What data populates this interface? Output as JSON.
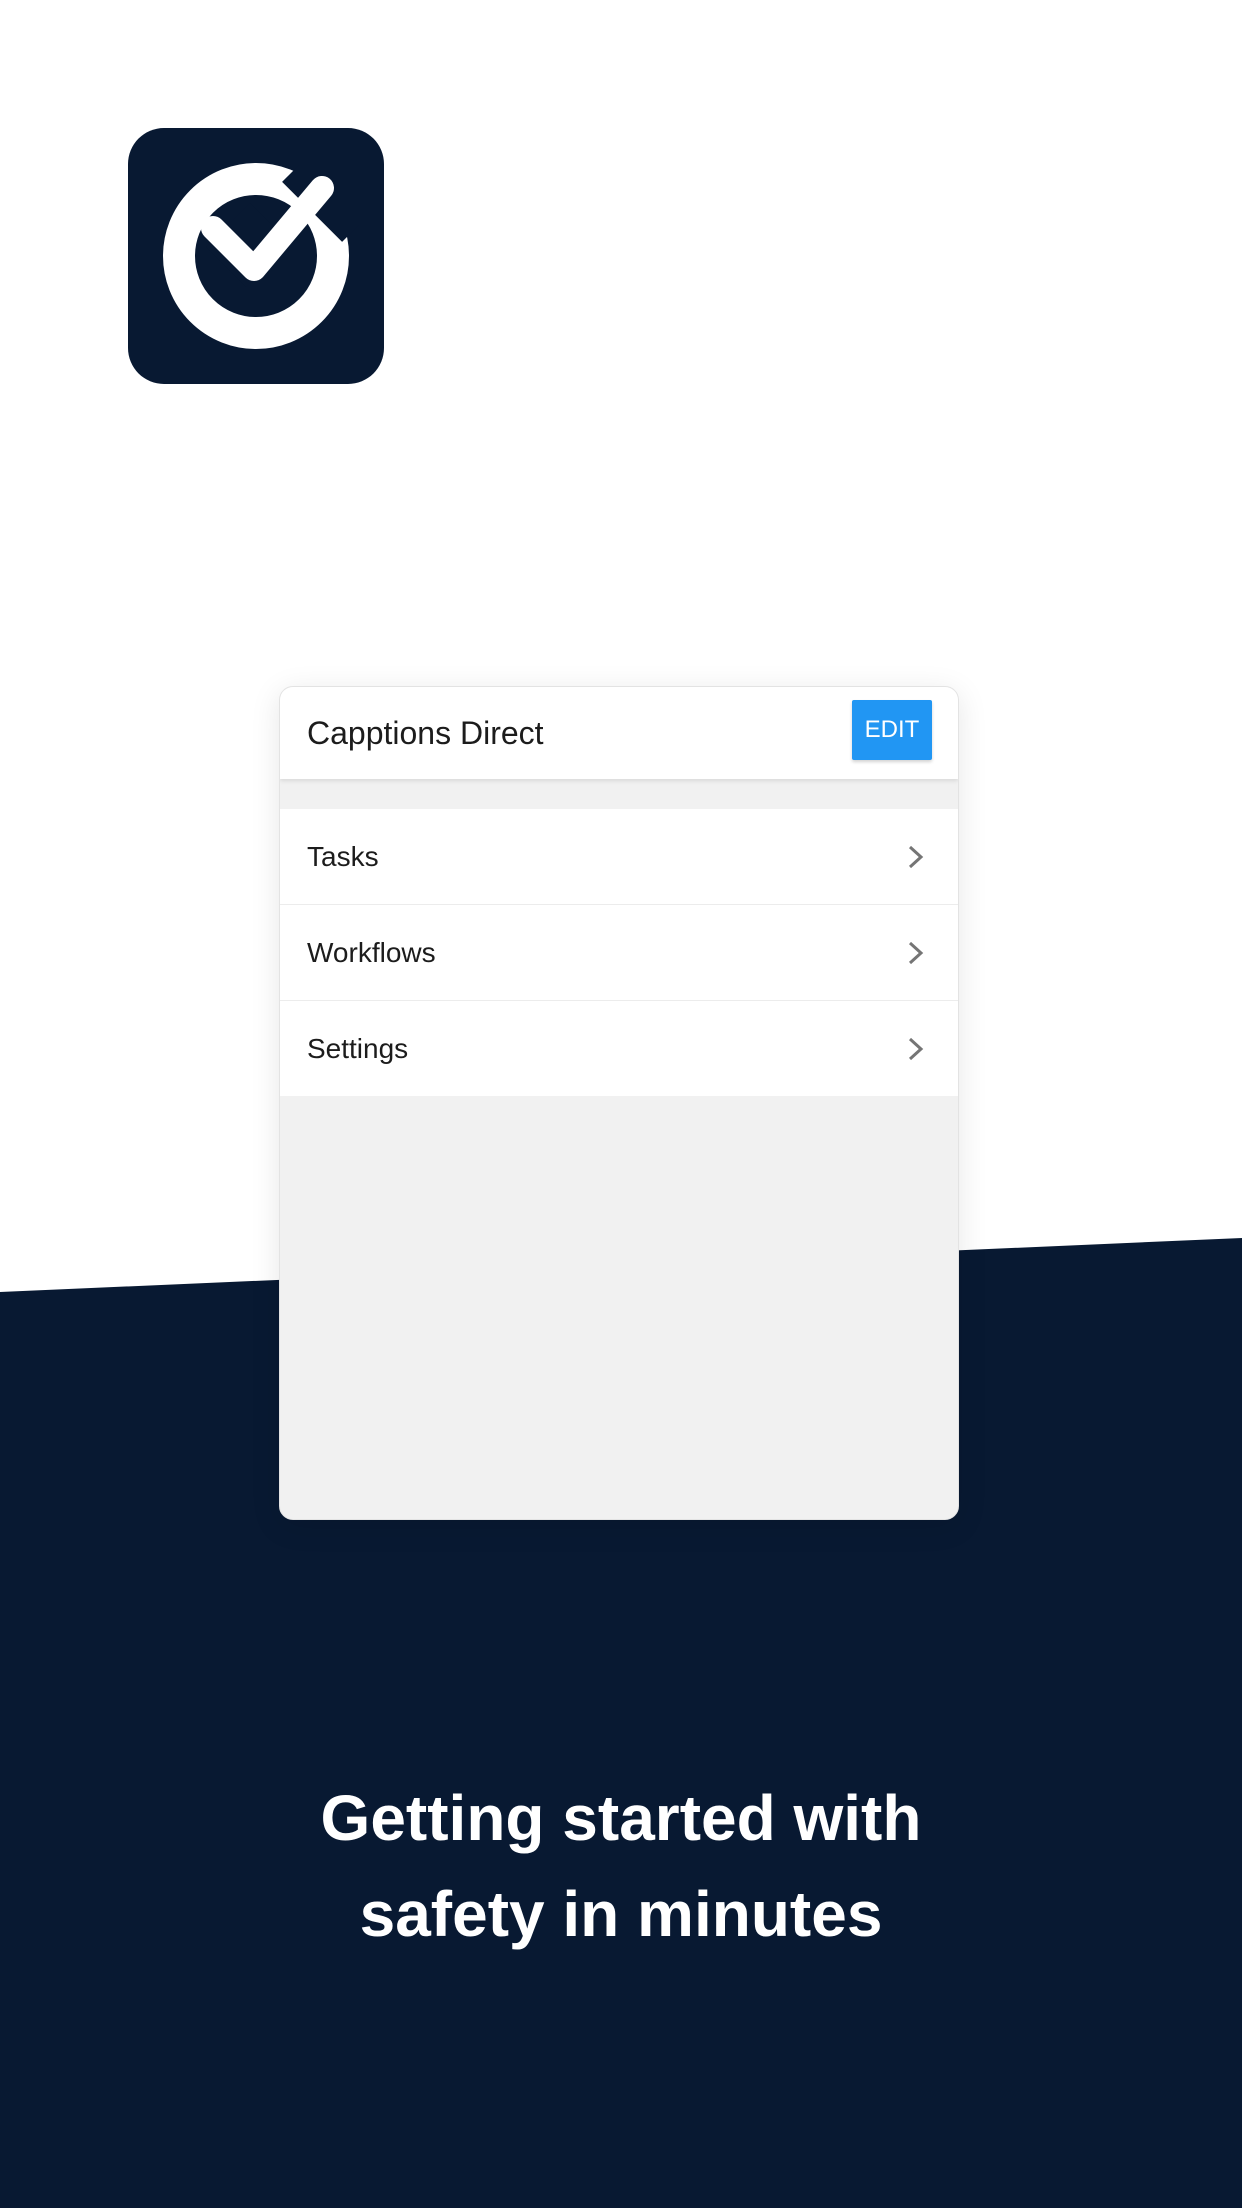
{
  "colors": {
    "navy": "#081932",
    "accent": "#2196f3",
    "card_background": "#f1f1f1",
    "white": "#ffffff"
  },
  "logo": {
    "icon": "check-circle-icon"
  },
  "card": {
    "title": "Capptions Direct",
    "edit_label": "EDIT",
    "menu_items": [
      {
        "label": "Tasks",
        "icon": "chevron-right-icon"
      },
      {
        "label": "Workflows",
        "icon": "chevron-right-icon"
      },
      {
        "label": "Settings",
        "icon": "chevron-right-icon"
      }
    ]
  },
  "headline": {
    "line1": "Getting started with",
    "line2": "safety in minutes"
  }
}
